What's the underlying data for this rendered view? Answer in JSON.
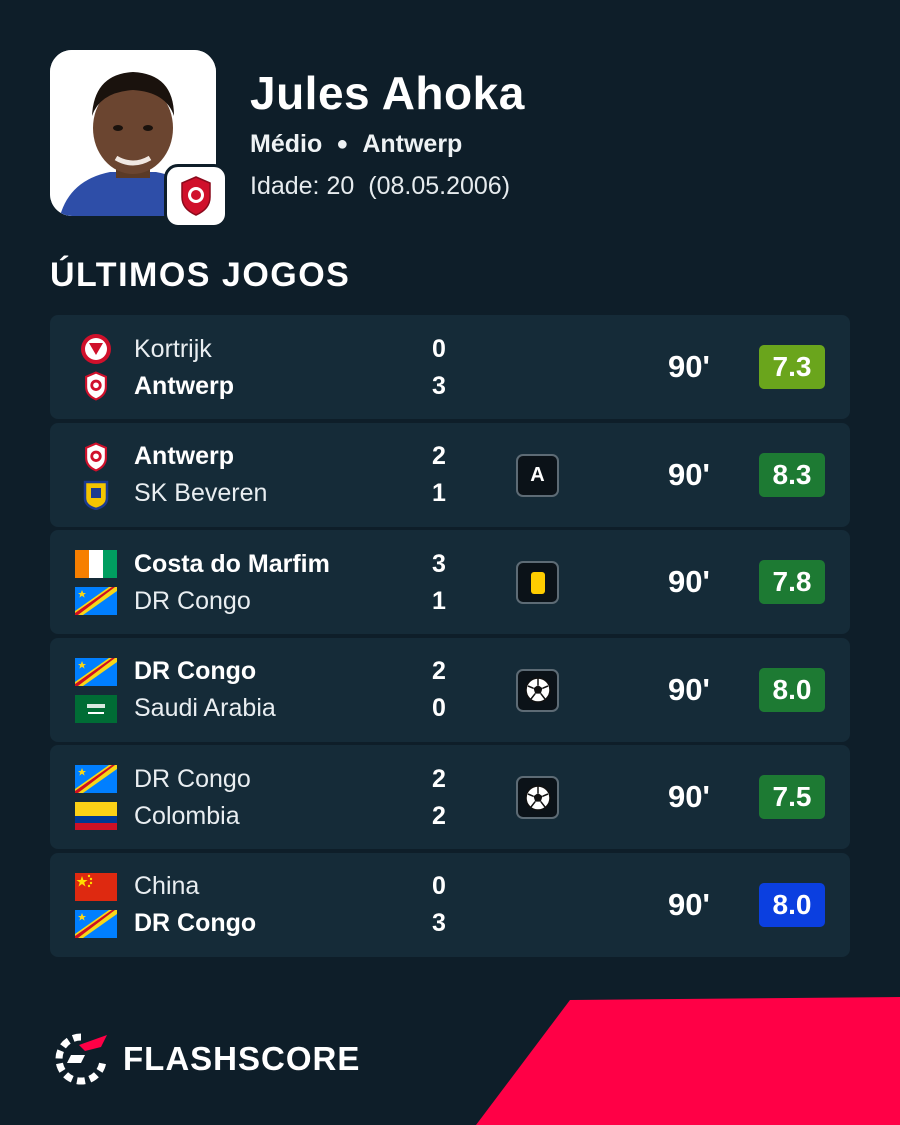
{
  "player": {
    "name": "Jules Ahoka",
    "position": "Médio",
    "club": "Antwerp",
    "age_label": "Idade: 20",
    "birthdate": "(08.05.2006)"
  },
  "section_title": "ÚLTIMOS JOGOS",
  "matches": [
    {
      "home": {
        "name": "Kortrijk",
        "score": "0",
        "logo": "kortrijk-crest",
        "bold": false
      },
      "away": {
        "name": "Antwerp",
        "score": "3",
        "logo": "antwerp-crest",
        "bold": true
      },
      "event": null,
      "minutes": "90'",
      "rating": "7.3",
      "rating_color": "#6aa51c"
    },
    {
      "home": {
        "name": "Antwerp",
        "score": "2",
        "logo": "antwerp-crest",
        "bold": true
      },
      "away": {
        "name": "SK Beveren",
        "score": "1",
        "logo": "beveren-crest",
        "bold": false
      },
      "event": {
        "type": "assist-icon",
        "label": "A"
      },
      "minutes": "90'",
      "rating": "8.3",
      "rating_color": "#1d7a33"
    },
    {
      "home": {
        "name": "Costa do Marfim",
        "score": "3",
        "logo": "ivory-coast-flag",
        "bold": true
      },
      "away": {
        "name": "DR Congo",
        "score": "1",
        "logo": "dr-congo-flag",
        "bold": false
      },
      "event": {
        "type": "yellow-card-icon",
        "label": ""
      },
      "minutes": "90'",
      "rating": "7.8",
      "rating_color": "#1d7a33"
    },
    {
      "home": {
        "name": "DR Congo",
        "score": "2",
        "logo": "dr-congo-flag",
        "bold": true
      },
      "away": {
        "name": "Saudi Arabia",
        "score": "0",
        "logo": "saudi-arabia-flag",
        "bold": false
      },
      "event": {
        "type": "goal-ball-icon",
        "label": ""
      },
      "minutes": "90'",
      "rating": "8.0",
      "rating_color": "#1d7a33"
    },
    {
      "home": {
        "name": "DR Congo",
        "score": "2",
        "logo": "dr-congo-flag",
        "bold": false
      },
      "away": {
        "name": "Colombia",
        "score": "2",
        "logo": "colombia-flag",
        "bold": false
      },
      "event": {
        "type": "goal-ball-icon",
        "label": ""
      },
      "minutes": "90'",
      "rating": "7.5",
      "rating_color": "#1d7a33"
    },
    {
      "home": {
        "name": "China",
        "score": "0",
        "logo": "china-flag",
        "bold": false
      },
      "away": {
        "name": "DR Congo",
        "score": "3",
        "logo": "dr-congo-flag",
        "bold": true
      },
      "event": null,
      "minutes": "90'",
      "rating": "8.0",
      "rating_color": "#0b3fe0"
    }
  ],
  "brand": {
    "name": "FLASHSCORE",
    "logo": "flashscore-logo-icon"
  },
  "colors": {
    "background": "#0e1e29",
    "card": "#152b38",
    "accent_red": "#ff0046"
  }
}
